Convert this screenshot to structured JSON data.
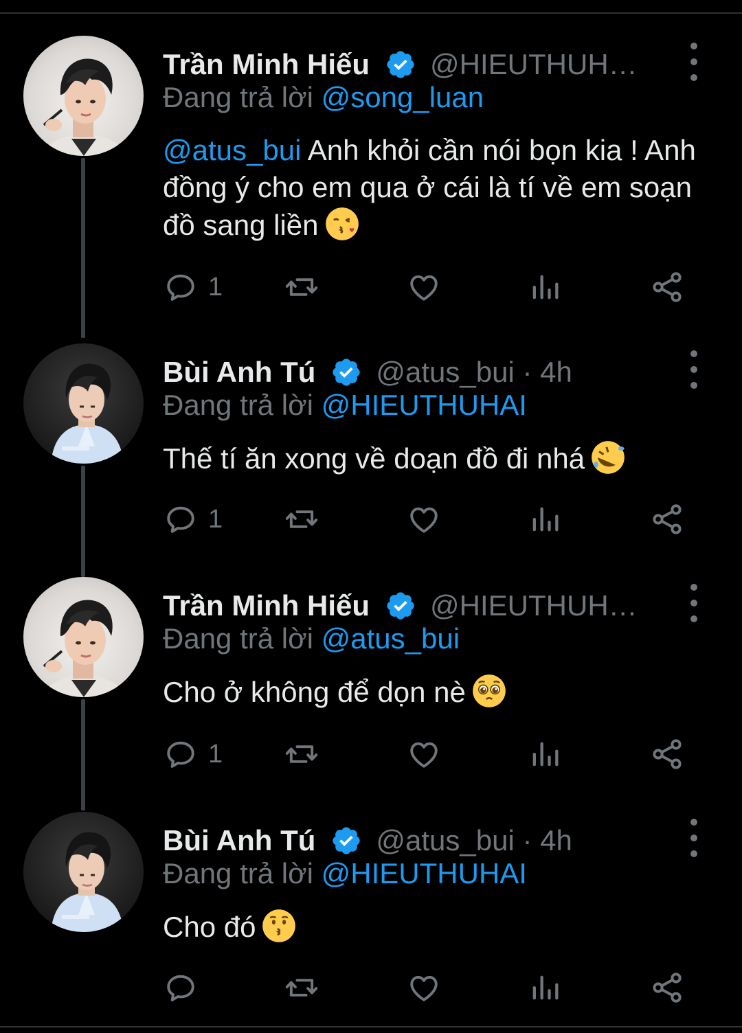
{
  "colors": {
    "background": "#000000",
    "text": "#e7e9ea",
    "muted": "#71767b",
    "link": "#1d9bf0",
    "verified": "#1d9bf0"
  },
  "tweets": [
    {
      "author": "Trần Minh Hiếu",
      "handle": "@HIEUTHUH…",
      "meta": "",
      "reply_prefix": "Đang trả lời ",
      "reply_to": "@song_luan",
      "mention": "@atus_bui",
      "text": " Anh khỏi cần nói bọn kia ! Anh đồng ý cho em qua ở cái là tí về em soạn đồ sang liền",
      "emoji": "face-throwing-kiss",
      "reply_count": "1",
      "avatar": "avatar-hieu"
    },
    {
      "author": "Bùi Anh Tú",
      "handle": "@atus_bui",
      "meta": " · 4h",
      "reply_prefix": "Đang trả lời ",
      "reply_to": "@HIEUTHUHAI",
      "mention": "",
      "text": "Thế tí ăn xong về doạn đồ đi nhá",
      "emoji": "rolling-on-floor-laughing",
      "reply_count": "1",
      "avatar": "avatar-tu"
    },
    {
      "author": "Trần Minh Hiếu",
      "handle": "@HIEUTHUH…",
      "meta": "",
      "reply_prefix": "Đang trả lời ",
      "reply_to": "@atus_bui",
      "mention": "",
      "text": "Cho ở không để dọn nè",
      "emoji": "pleading-face",
      "reply_count": "1",
      "avatar": "avatar-hieu"
    },
    {
      "author": "Bùi Anh Tú",
      "handle": "@atus_bui",
      "meta": " · 4h",
      "reply_prefix": "Đang trả lời ",
      "reply_to": "@HIEUTHUHAI",
      "mention": "",
      "text": "Cho đó",
      "emoji": "kissing-face",
      "reply_count": "",
      "avatar": "avatar-tu"
    }
  ],
  "icons": {
    "reply": "reply-icon",
    "retweet": "retweet-icon",
    "like": "like-icon",
    "views": "views-icon",
    "share": "share-icon",
    "more": "more-options-icon",
    "verified": "verified-badge-icon"
  }
}
